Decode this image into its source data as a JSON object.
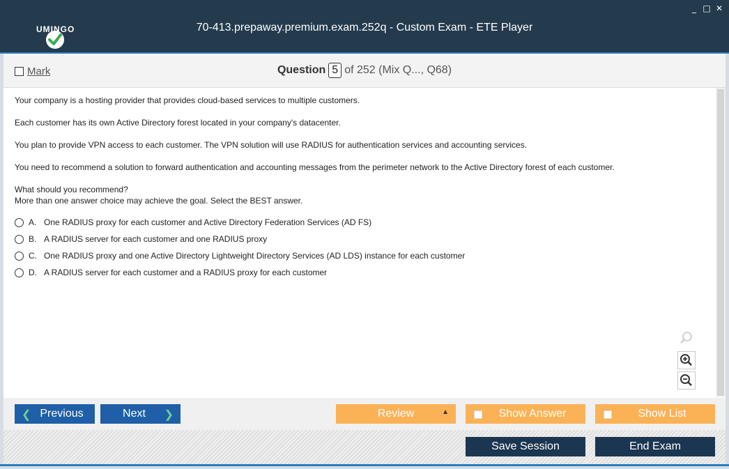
{
  "window": {
    "title": "70-413.prepaway.premium.exam.252q - Custom Exam - ETE Player",
    "logo_text": "UMINGO",
    "controls": {
      "minimize": "_",
      "maximize": "□",
      "close": "✕"
    }
  },
  "question_bar": {
    "mark_label": "Mark",
    "question_label": "Question",
    "current_number": "5",
    "total_text": "of 252 (Mix Q..., Q68)"
  },
  "question": {
    "paragraphs": [
      "Your company is a hosting provider that provides cloud-based services to multiple customers.",
      "Each customer has its own Active Directory forest located in your company's datacenter.",
      "You plan to provide VPN access to each customer. The VPN solution will use RADIUS for authentication services and accounting services.",
      "You need to recommend a solution to forward authentication and accounting messages from the perimeter network to the Active Directory forest of each customer.",
      "What should you recommend?",
      "More than one answer choice may achieve the goal. Select the BEST answer."
    ],
    "options": [
      {
        "letter": "A.",
        "text": "One RADIUS proxy for each customer and Active Directory Federation Services (AD FS)"
      },
      {
        "letter": "B.",
        "text": "A RADIUS server for each customer and one RADIUS proxy"
      },
      {
        "letter": "C.",
        "text": "One RADIUS proxy and one Active Directory Lightweight Directory Services (AD LDS) instance for each customer"
      },
      {
        "letter": "D.",
        "text": "A RADIUS server for each customer and a RADIUS proxy for each customer"
      }
    ]
  },
  "zoom_tools": {
    "icons": [
      "search-icon",
      "zoom-in-icon",
      "zoom-out-icon"
    ]
  },
  "nav": {
    "previous_label": "Previous",
    "next_label": "Next",
    "review_label": "Review",
    "show_answer_label": "Show Answer",
    "show_list_label": "Show List"
  },
  "session": {
    "save_label": "Save Session",
    "end_label": "End Exam"
  },
  "colors": {
    "titlebar": "#243a4d",
    "accent_blue": "#1f5fa8",
    "orange": "#fbb256",
    "dark_button": "#1b3651",
    "chevron_green": "#6fd08a"
  }
}
